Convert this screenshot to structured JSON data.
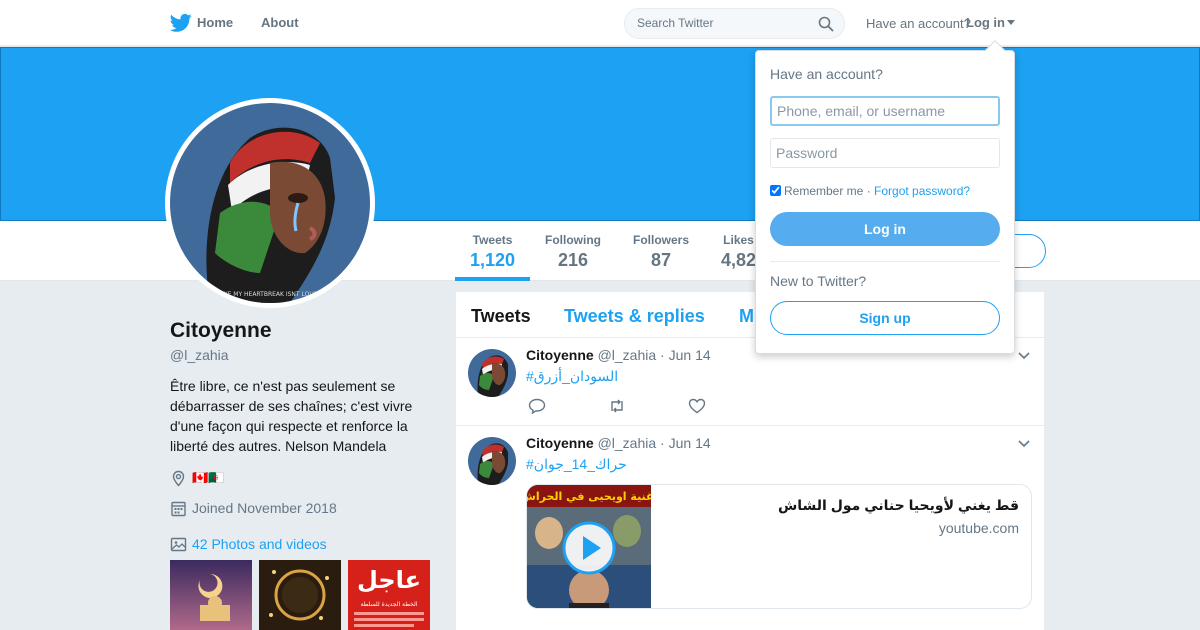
{
  "nav": {
    "home": "Home",
    "about": "About",
    "search_placeholder": "Search Twitter",
    "have_account": "Have an account?",
    "login": "Log in"
  },
  "stats": [
    {
      "label": "Tweets",
      "value": "1,120"
    },
    {
      "label": "Following",
      "value": "216"
    },
    {
      "label": "Followers",
      "value": "87"
    },
    {
      "label": "Likes",
      "value": "4,82"
    }
  ],
  "profile": {
    "name": "Citoyenne",
    "handle": "@l_zahia",
    "bio": "Être libre, ce n'est pas seulement se débarrasser de ses chaînes; c'est vivre d'une façon qui respecte et renforce la liberté des autres. Nelson Mandela",
    "location": "🇨🇦🇩🇿",
    "joined": "Joined November 2018",
    "photos": "42 Photos and videos",
    "avatar_caption": "WE MY HEARTBREAK ISNT LOUD",
    "thumb3_title": "عاجل",
    "thumb3_sub": "الخطة الجديدة للسلطة"
  },
  "tabs": [
    {
      "label": "Tweets"
    },
    {
      "label": "Tweets & replies"
    },
    {
      "label": "M"
    }
  ],
  "tweets": [
    {
      "name": "Citoyenne",
      "handle": "@l_zahia",
      "dot": "·",
      "date": "Jun 14",
      "text": "#السودان_أزرق"
    },
    {
      "name": "Citoyenne",
      "handle": "@l_zahia",
      "dot": "·",
      "date": "Jun 14",
      "text": "#حراك_14_جوان",
      "card": {
        "title": "قط يغني لأويحيا حناني مول الشاش",
        "domain": "youtube.com",
        "img_text": "أغنية اويحيى في الحراش"
      }
    }
  ],
  "login_dropdown": {
    "title": "Have an account?",
    "username_placeholder": "Phone, email, or username",
    "password_placeholder": "Password",
    "remember": "Remember me",
    "sep": " · ",
    "forgot": "Forgot password?",
    "login_button": "Log in",
    "new_prompt": "New to Twitter?",
    "signup_button": "Sign up"
  },
  "colors": {
    "accent": "#1da1f2",
    "banner": "#1da1f2",
    "login_button": "#55acee",
    "background": "#e6ecf0"
  },
  "icons": [
    "twitter-logo-icon",
    "search-icon",
    "caret-down-icon",
    "location-pin-icon",
    "calendar-icon",
    "photo-icon",
    "chevron-down-icon",
    "reply-icon",
    "retweet-icon",
    "like-icon",
    "play-icon"
  ]
}
